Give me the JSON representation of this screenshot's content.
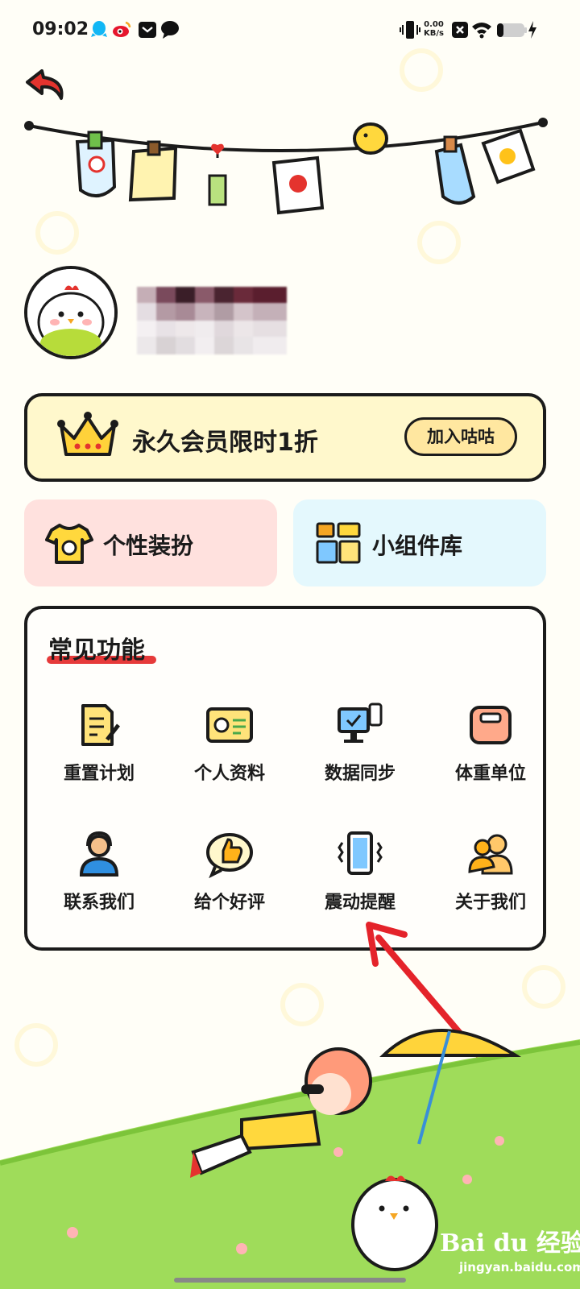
{
  "status_bar": {
    "time": "09:02",
    "net_speed_value": "0.00",
    "net_speed_unit": "KB/s",
    "icons": [
      "qq-icon",
      "weibo-icon",
      "message-icon",
      "chat-bubble-icon",
      "vibrate-icon",
      "close-box-icon",
      "wifi-icon",
      "battery-icon",
      "charging-icon"
    ]
  },
  "vip": {
    "title": "永久会员限时1折",
    "join_label": "加入咕咕"
  },
  "tiles": [
    {
      "label": "个性装扮",
      "icon": "tshirt-icon"
    },
    {
      "label": "小组件库",
      "icon": "widget-library-icon"
    }
  ],
  "functions": {
    "title": "常见功能",
    "items": [
      {
        "label": "重置计划",
        "icon": "reset-plan-icon"
      },
      {
        "label": "个人资料",
        "icon": "profile-card-icon"
      },
      {
        "label": "数据同步",
        "icon": "sync-icon"
      },
      {
        "label": "体重单位",
        "icon": "scale-icon"
      },
      {
        "label": "联系我们",
        "icon": "customer-service-icon"
      },
      {
        "label": "给个好评",
        "icon": "thumbs-up-icon"
      },
      {
        "label": "震动提醒",
        "icon": "vibration-icon"
      },
      {
        "label": "关于我们",
        "icon": "about-us-icon"
      }
    ]
  },
  "watermark": {
    "brand": "Bai du 经验",
    "url": "jingyan.baidu.com"
  },
  "colors": {
    "accent_red": "#e63a3a",
    "vip_bg": "#fff8cc",
    "dress_tile": "#ffe1de",
    "widget_tile": "#e4f8fd",
    "yellow": "#ffd83d"
  }
}
